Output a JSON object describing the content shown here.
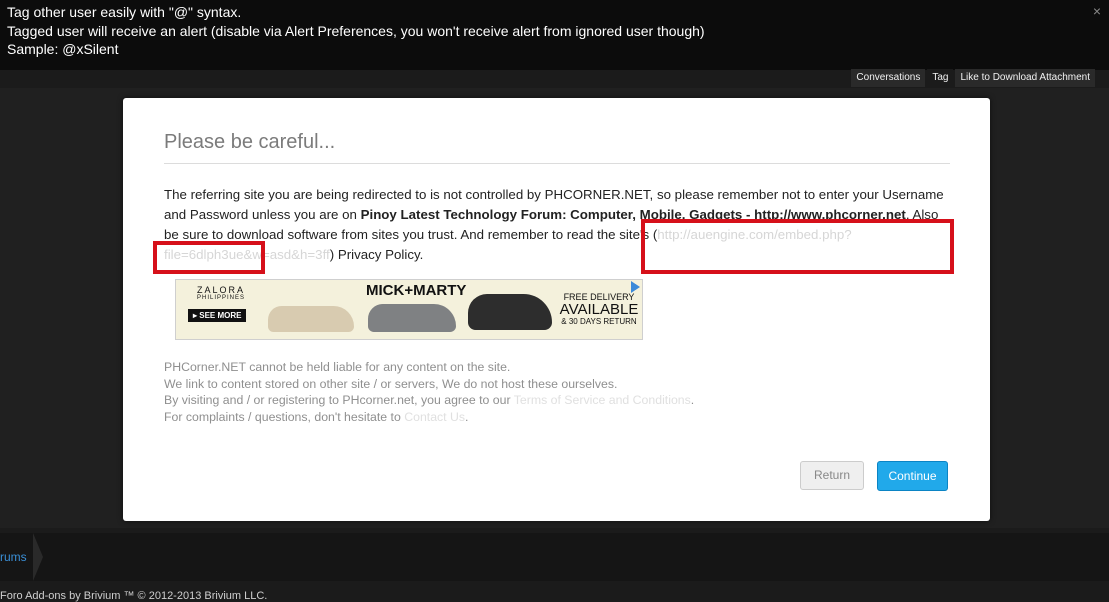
{
  "topbar": {
    "line1": "Tag other user easily with \"@\" syntax.",
    "line2": "Tagged user will receive an alert (disable via Alert Preferences, you won't receive alert from ignored user though)",
    "line3": "Sample: @xSilent",
    "close_icon": "×"
  },
  "tabs": [
    "Conversations",
    "Tag",
    "Like to Download Attachment"
  ],
  "modal": {
    "title": "Please be careful...",
    "notice_part1": "The referring site you are being redirected to is not controlled by PHCORNER.NET, so please remember not to enter your Username and Password unless you are on ",
    "notice_bold": "Pinoy Latest Technology Forum: Computer, Mobile, Gadgets - http://www.phcorner.net",
    "notice_part2": ". Also be sure to download software from sites you trust. And remember to read the site's (",
    "notice_link": "http://auengine.com/embed.php?file=6dlph3ue&w=asd&h=3ff",
    "notice_part3": ") Privacy Policy.",
    "ad": {
      "brand": "ZALORA",
      "brand_sub": "PHILIPPINES",
      "see_more": "▸ SEE MORE",
      "mick": "MICK+MARTY",
      "del_a": "FREE DELIVERY",
      "del_b": "AVAILABLE",
      "del_c": "& 30 DAYS RETURN"
    },
    "disclaimer": {
      "line1": "PHCorner.NET cannot be held liable for any content on the site.",
      "line2": "We link to content stored on other site / or servers, We do not host these ourselves.",
      "line3_pre": "By visiting and / or registering to PHcorner.net, you agree to our ",
      "line3_link": "Terms of Service and Conditions",
      "line3_post": ".",
      "line4_pre": "For complaints / questions, don't hesitate to ",
      "line4_link": "Contact Us",
      "line4_post": "."
    },
    "return_label": "Return",
    "continue_label": "Continue"
  },
  "footer": {
    "crumb": "rums",
    "copyright": "Foro Add-ons by Brivium ™ © 2012-2013 Brivium LLC."
  }
}
